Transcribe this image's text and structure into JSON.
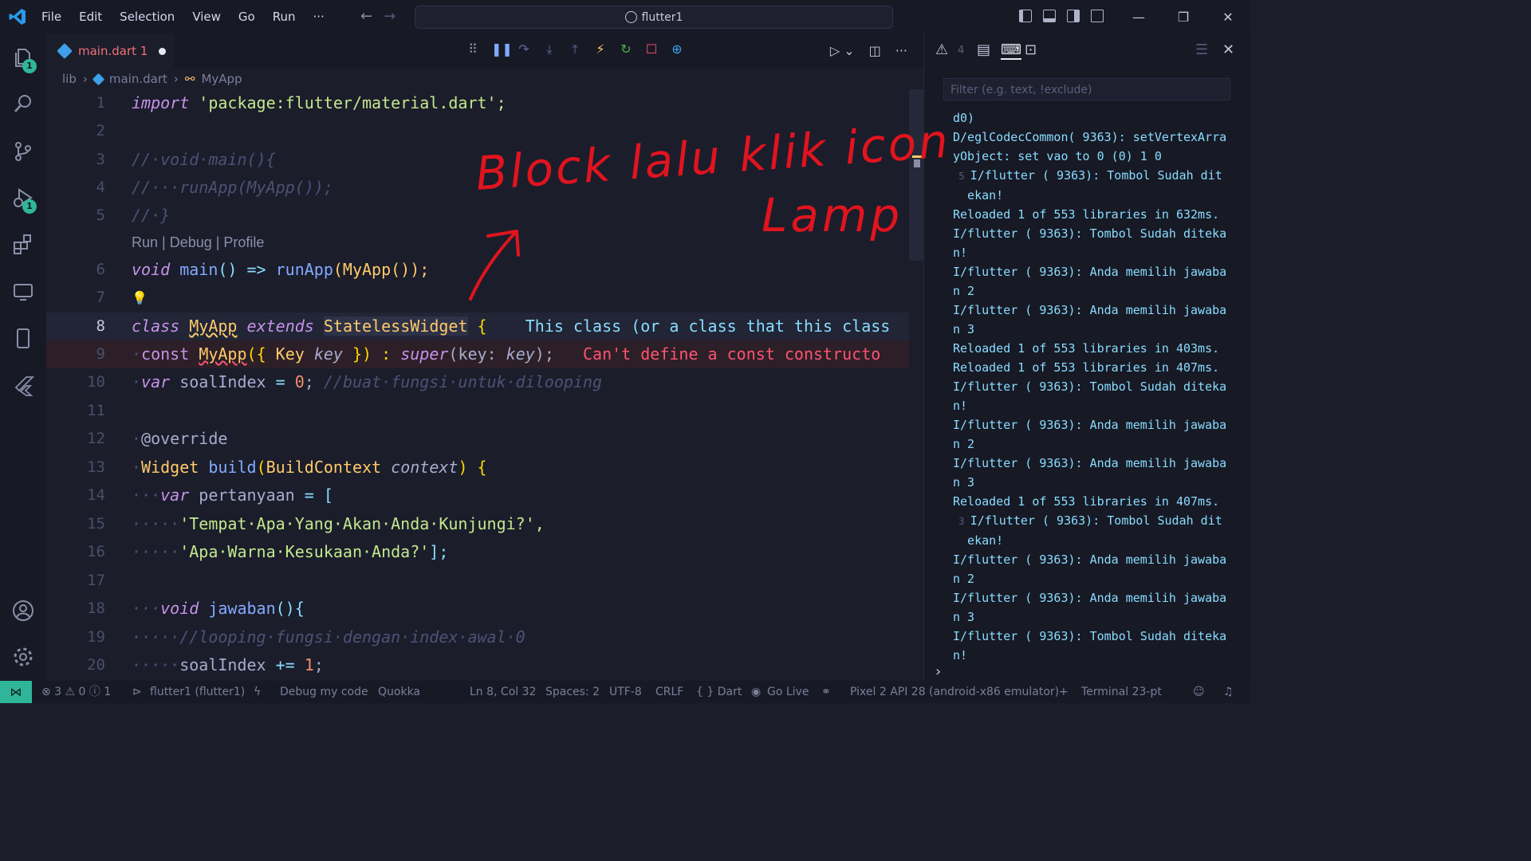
{
  "menu": [
    "File",
    "Edit",
    "Selection",
    "View",
    "Go",
    "Run",
    "···"
  ],
  "command_center": "flutter1",
  "window_controls": [
    "—",
    "❐",
    "✕"
  ],
  "activity_badges": {
    "explorer": "1",
    "debug": "1"
  },
  "tab": {
    "name": "main.dart 1",
    "modified": true
  },
  "breadcrumb": {
    "folder": "lib",
    "file": "main.dart",
    "symbol": "MyApp"
  },
  "codelens": "Run | Debug | Profile",
  "line_numbers": [
    "1",
    "2",
    "3",
    "4",
    "5",
    "6",
    "7",
    "8",
    "9",
    "10",
    "11",
    "12",
    "13",
    "14",
    "15",
    "16",
    "17",
    "18",
    "19",
    "20"
  ],
  "code": {
    "l1_kw": "import",
    "l1_str": "'package:flutter/material.dart';",
    "l3": "//·void·main(){",
    "l4": "//···runApp(MyApp());",
    "l5": "//·}",
    "l6_kw": "void",
    "l6_fn": "main",
    "l6_rest": "() => ",
    "l6_fn2": "runApp",
    "l6_call": "(MyApp());",
    "l8_kw": "class",
    "l8_cls": "MyApp",
    "l8_kw2": "extends",
    "l8_base": "StatelessWidget",
    "l8_brace": "{",
    "l8_hint": "This class (or a class that this class",
    "l9_kw": "const",
    "l9_cls": "MyApp",
    "l9_a": "({ ",
    "l9_ty": "Key",
    "l9_key": "key",
    "l9_b": " }) : ",
    "l9_super": "super",
    "l9_c": "(key: ",
    "l9_key2": "key",
    "l9_d": ");",
    "l9_err": "Can't define a const constructo",
    "l10_kw": "var",
    "l10_name": "soalIndex",
    "l10_eq": " = ",
    "l10_num": "0",
    "l10_semi": ";",
    "l10_cm": "//buat·fungsi·untuk·dilooping",
    "l12": "@override",
    "l13_ty": "Widget",
    "l13_fn": "build",
    "l13_a": "(",
    "l13_ty2": "BuildContext",
    "l13_arg": "context",
    "l13_b": ") {",
    "l14_kw": "var",
    "l14_name": "pertanyaan",
    "l14_eq": " = [",
    "l15": "'Tempat·Apa·Yang·Akan·Anda·Kunjungi?',",
    "l16": "'Apa·Warna·Kesukaan·Anda?'",
    "l16_end": "];",
    "l18_kw": "void",
    "l18_fn": "jawaban",
    "l18_rest": "(){",
    "l19": "//looping·fungsi·dengan·index·awal·0",
    "l20_name": "soalIndex",
    "l20_op": " += ",
    "l20_num": "1",
    "l20_semi": ";"
  },
  "panel": {
    "problems_count": "4",
    "filter_placeholder": "Filter (e.g. text, !exclude)",
    "output": [
      {
        "text": "d0)"
      },
      {
        "text": "D/eglCodecCommon( 9363): setVertexArra"
      },
      {
        "text": "yObject: set vao to 0 (0) 1 0"
      },
      {
        "count": "5",
        "text": "I/flutter ( 9363): Tombol Sudah dit"
      },
      {
        "text": "  ekan!",
        "indent": true
      },
      {
        "text": "Reloaded 1 of 553 libraries in 632ms."
      },
      {
        "text": "I/flutter ( 9363): Tombol Sudah diteka"
      },
      {
        "text": "n!"
      },
      {
        "text": "I/flutter ( 9363): Anda memilih jawaba"
      },
      {
        "text": "n 2"
      },
      {
        "text": "I/flutter ( 9363): Anda memilih jawaba"
      },
      {
        "text": "n 3"
      },
      {
        "text": "Reloaded 1 of 553 libraries in 403ms."
      },
      {
        "text": "Reloaded 1 of 553 libraries in 407ms."
      },
      {
        "text": "I/flutter ( 9363): Tombol Sudah diteka"
      },
      {
        "text": "n!"
      },
      {
        "text": "I/flutter ( 9363): Anda memilih jawaba"
      },
      {
        "text": "n 2"
      },
      {
        "text": "I/flutter ( 9363): Anda memilih jawaba"
      },
      {
        "text": "n 3"
      },
      {
        "text": "Reloaded 1 of 553 libraries in 407ms."
      },
      {
        "count": "3",
        "text": "I/flutter ( 9363): Tombol Sudah dit"
      },
      {
        "text": "  ekan!",
        "indent": true
      },
      {
        "text": "I/flutter ( 9363): Anda memilih jawaba"
      },
      {
        "text": "n 2"
      },
      {
        "text": "I/flutter ( 9363): Anda memilih jawaba"
      },
      {
        "text": "n 3"
      },
      {
        "text": "I/flutter ( 9363): Tombol Sudah diteka"
      },
      {
        "text": "n!"
      }
    ]
  },
  "status": {
    "problems": "⊗ 3 ⚠ 0 ⓘ 1",
    "debug_target": "flutter1 (flutter1)",
    "debug_my_code": "Debug my code",
    "quokka": "Quokka",
    "cursor": "Ln 8, Col 32",
    "spaces": "Spaces: 2",
    "encoding": "UTF-8",
    "eol": "CRLF",
    "language": "{ } Dart",
    "golive": "Go Live",
    "device": "Pixel 2 API 28 (android-x86 emulator)",
    "terminal": "Terminal 23-pt"
  },
  "annotation": {
    "line1": "Block lalu klik icon",
    "line2": "Lamp",
    "color": "#e0141e"
  }
}
